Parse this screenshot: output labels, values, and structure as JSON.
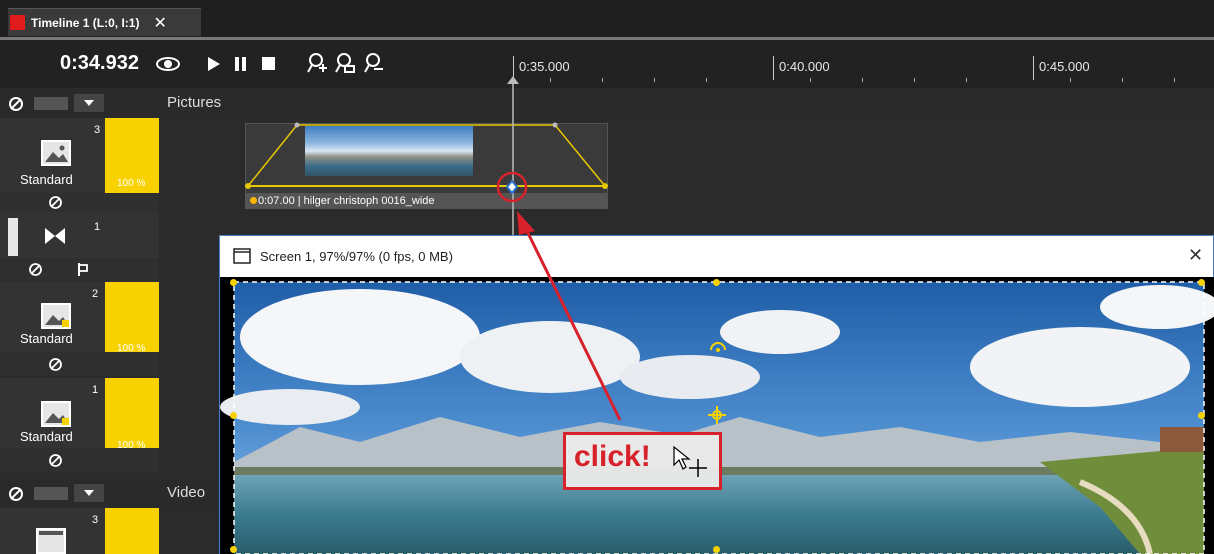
{
  "tab": {
    "title": "Timeline 1 (L:0, I:1)",
    "close_glyph": "✕",
    "color": "#e01b1b"
  },
  "toolbar": {
    "timecode": "0:34.932",
    "icons": [
      "eye-icon",
      "play-icon",
      "pause-icon",
      "stop-icon",
      "zoom-in-icon",
      "zoom-fit-icon",
      "zoom-out-icon"
    ]
  },
  "ruler": {
    "labels": [
      "0:35.000",
      "0:40.000",
      "0:45.000"
    ]
  },
  "tracks": {
    "pictures_label": "Pictures",
    "video_label": "Video",
    "track3": {
      "index": "3",
      "name": "Standard",
      "opacity": "100 %"
    },
    "transition": {
      "index": "1"
    },
    "track2": {
      "index": "2",
      "name": "Standard",
      "opacity": "100 %"
    },
    "track1": {
      "index": "1",
      "name": "Standard",
      "opacity": "100 %"
    },
    "video_track": {
      "index": "3"
    }
  },
  "clip": {
    "label": "0:07.00 | hilger christoph 0016_wide"
  },
  "screen": {
    "title": "Screen 1, 97%/97% (0 fps, 0 MB)",
    "close_glyph": "✕"
  },
  "annotation": {
    "callout_text": "click!",
    "color": "#d7212b"
  }
}
